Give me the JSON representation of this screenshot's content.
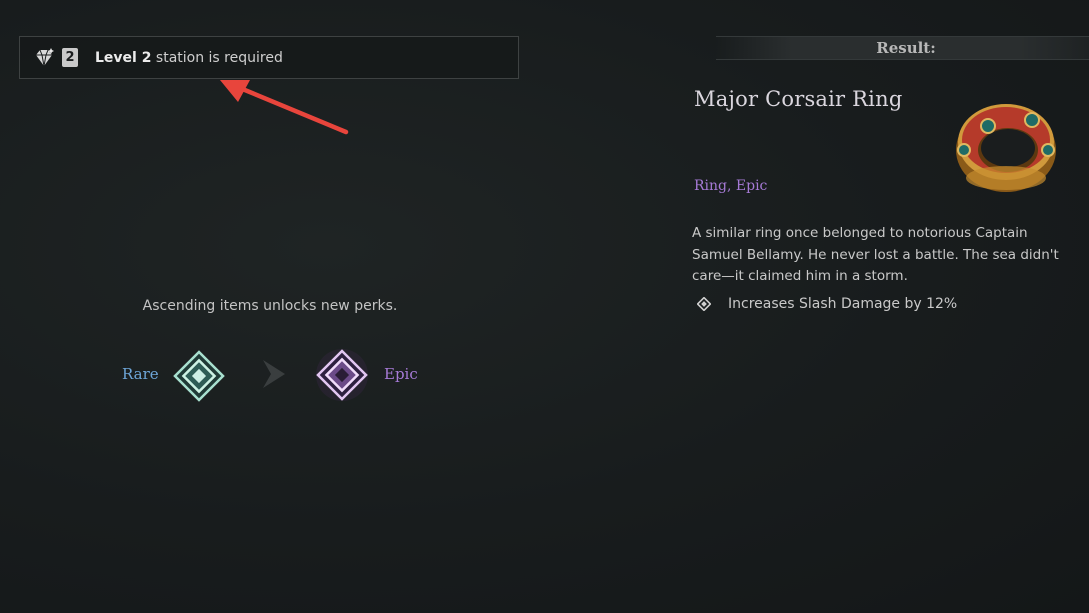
{
  "requirement": {
    "icon": "gem-icon",
    "level_badge": "2",
    "level_text": "Level 2",
    "rest_text": "station is required"
  },
  "ascend": {
    "caption": "Ascending items unlocks new perks.",
    "from_label": "Rare",
    "to_label": "Epic",
    "from_color": "#6ea6d8",
    "to_color": "#a67ad6"
  },
  "result": {
    "header": "Result:",
    "item_name": "Major Corsair Ring",
    "item_type": "Ring, Epic",
    "description": "A similar ring once belonged to notorious Captain Samuel Bellamy. He never lost a battle. The sea didn't care—it claimed him in a storm.",
    "perk": "Increases Slash Damage by 12%"
  },
  "annotation": {
    "arrow_color": "#e8453c"
  }
}
